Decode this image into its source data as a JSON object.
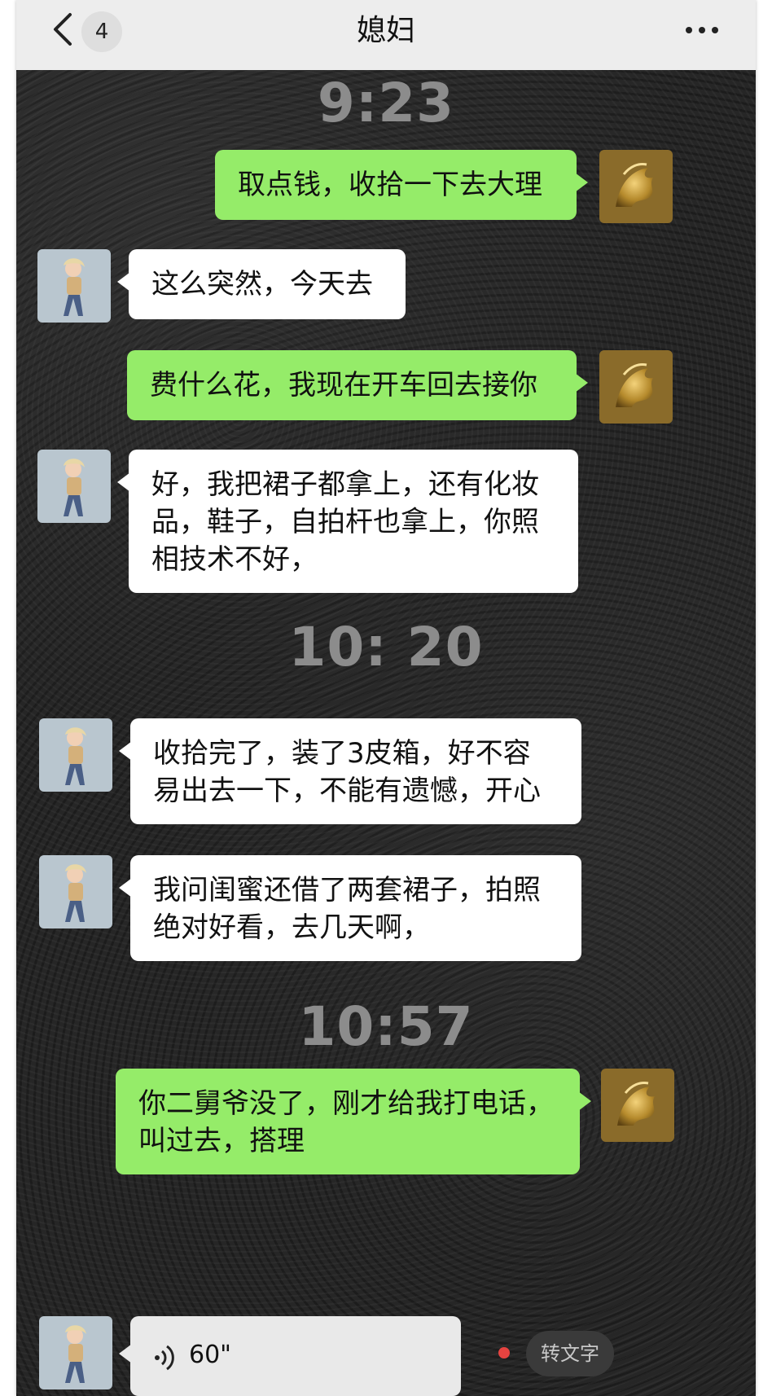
{
  "header": {
    "back_label": "back",
    "unread_count": "4",
    "title": "媳妇"
  },
  "timestamps": [
    "9:23",
    "10: 20",
    "10:57"
  ],
  "messages": [
    {
      "side": "right",
      "lines": [
        "取点钱，收拾一下去大理"
      ]
    },
    {
      "side": "left",
      "lines": [
        "这么突然，今天去"
      ]
    },
    {
      "side": "right",
      "lines": [
        "费什么花，我现在开车回去接你"
      ]
    },
    {
      "side": "left",
      "lines": [
        "好，我把裙子都拿上，还有化妆",
        "品，鞋子，自拍杆也拿上，你照",
        "相技术不好，"
      ]
    },
    {
      "side": "left",
      "lines": [
        "收拾完了，装了3皮箱，好不容",
        "易出去一下，不能有遗憾，开心"
      ]
    },
    {
      "side": "left",
      "lines": [
        "我问闺蜜还借了两套裙子，拍照",
        "绝对好看，去几天啊，"
      ]
    },
    {
      "side": "right",
      "lines": [
        "你二舅爷没了，刚才给我打电话，",
        "叫过去，搭理"
      ]
    }
  ],
  "voice": {
    "duration": "60\"",
    "convert_label": "转文字"
  },
  "colors": {
    "header_bg": "#ededed",
    "chat_bg": "#262626",
    "sent_bubble": "#95ec69",
    "received_bubble": "#ffffff",
    "timestamp": "#8c8c8c",
    "unread_dot": "#e64340"
  },
  "icons": [
    "back-chevron-icon",
    "more-dots-icon",
    "dragon-avatar",
    "girl-avatar",
    "voice-wave-icon"
  ]
}
